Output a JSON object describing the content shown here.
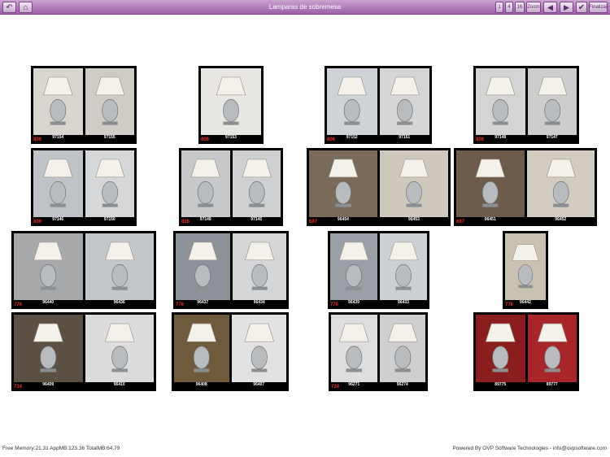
{
  "toolbar": {
    "title": "Lamparas de sobremesa",
    "back_label": "↶",
    "home_label": "⌂",
    "page_buttons": [
      "1",
      "4",
      "16"
    ],
    "zoom_label": "Zoom",
    "prev_label": "◀",
    "next_label": "▶",
    "done_label": "Finalizar"
  },
  "colors": {
    "toolbar": "#9b5ea6",
    "accent": "#e5322b"
  },
  "products": [
    {
      "tag": "806",
      "codes": [
        "97154",
        "97155"
      ]
    },
    {
      "tag": "806",
      "codes": [
        "97153"
      ]
    },
    {
      "tag": "806",
      "codes": [
        "97152",
        "97151"
      ]
    },
    {
      "tag": "806",
      "codes": [
        "97148",
        "97147"
      ]
    },
    {
      "tag": "806",
      "codes": [
        "97146",
        "97150"
      ]
    },
    {
      "tag": "806",
      "codes": [
        "97149",
        "97145"
      ]
    },
    {
      "tag": "697",
      "codes": [
        "96454",
        "96453"
      ]
    },
    {
      "tag": "697",
      "codes": [
        "96451",
        "96452"
      ]
    },
    {
      "tag": "776",
      "codes": [
        "96440",
        "96436"
      ]
    },
    {
      "tag": "776",
      "codes": [
        "96437",
        "96434"
      ]
    },
    {
      "tag": "776",
      "codes": [
        "96439",
        "96433"
      ]
    },
    {
      "tag": "776",
      "codes": [
        "96442"
      ]
    },
    {
      "tag": "734",
      "codes": [
        "96409",
        "96410"
      ]
    },
    {
      "tag": "",
      "codes": [
        "96408",
        "96407"
      ]
    },
    {
      "tag": "734",
      "codes": [
        "96271",
        "96274"
      ]
    },
    {
      "tag": "",
      "codes": [
        "89775",
        "89777"
      ]
    }
  ],
  "footer": {
    "memory": "Free Memory:21.31 AppMB:123.36 TotalMB:64.79",
    "powered": "Powered By OVP Software Technologies - info@ovpsoftware.com"
  }
}
